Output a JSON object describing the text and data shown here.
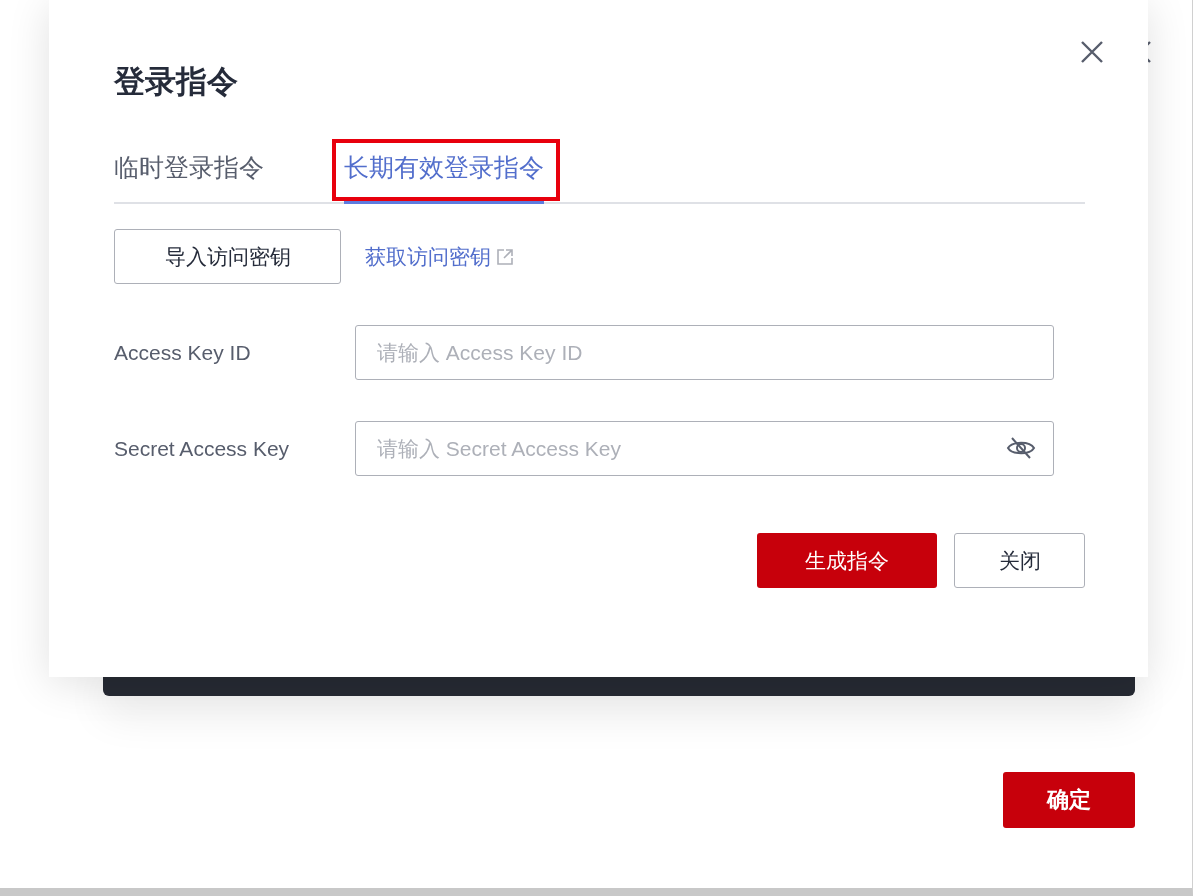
{
  "background_dialog": {
    "confirm_button": "确定"
  },
  "dialog": {
    "title": "登录指令",
    "tabs": [
      {
        "label": "临时登录指令",
        "selected": false,
        "highlighted": false
      },
      {
        "label": "长期有效登录指令",
        "selected": true,
        "highlighted": true
      }
    ],
    "import_button": "导入访问密钥",
    "get_key_link": "获取访问密钥",
    "fields": [
      {
        "label": "Access Key ID",
        "placeholder": "请输入 Access Key ID",
        "kind": "text"
      },
      {
        "label": "Secret Access Key",
        "placeholder": "请输入 Secret Access Key",
        "kind": "password"
      }
    ],
    "buttons": [
      {
        "label": "生成指令",
        "kind": "primary"
      },
      {
        "label": "关闭",
        "kind": "secondary"
      }
    ]
  }
}
